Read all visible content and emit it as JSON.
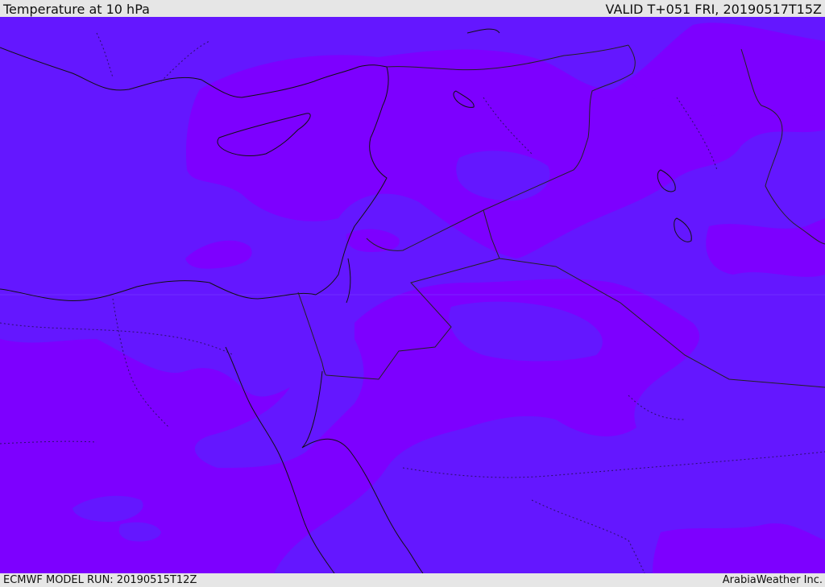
{
  "header": {
    "title": "Temperature at 10 hPa",
    "valid_time": "VALID T+051 FRI, 20190517T15Z"
  },
  "footer": {
    "model_run": "ECMWF MODEL RUN: 20190515T12Z",
    "brand": "ArabiaWeather Inc."
  },
  "map": {
    "colors": {
      "background_field": "#6417ff",
      "warm_field": "#7d00ff",
      "coastline": "#111111",
      "border": "#222222"
    }
  }
}
